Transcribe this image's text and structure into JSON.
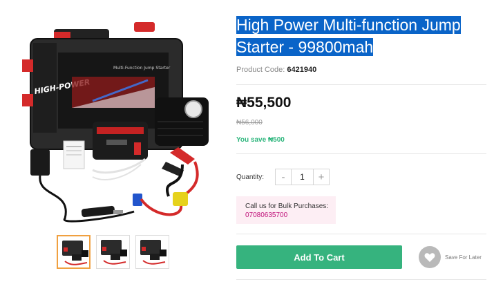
{
  "product": {
    "title": "High Power Multi-function Jump Starter - 99800mah",
    "code_label": "Product Code:",
    "code": "6421940",
    "price": "₦55,500",
    "old_price": "₦56,000",
    "savings": "You save ₦500"
  },
  "case_graphics": {
    "brand_text": "HIGH-POWER",
    "lid_text": "Multi-Function Jump Starter"
  },
  "quantity": {
    "label": "Quantity:",
    "minus": "-",
    "value": "1",
    "plus": "+"
  },
  "bulk": {
    "label": "Call us for Bulk Purchases:",
    "phone": "07080635700"
  },
  "actions": {
    "add_to_cart": "Add To Cart",
    "save_for_later": "Save For Later"
  },
  "colors": {
    "accent_green": "#36b37e",
    "savings_green": "#2eb67d",
    "title_highlight": "#0a64c8",
    "bulk_bg": "#fdeef4",
    "bulk_phone": "#c0127a"
  }
}
